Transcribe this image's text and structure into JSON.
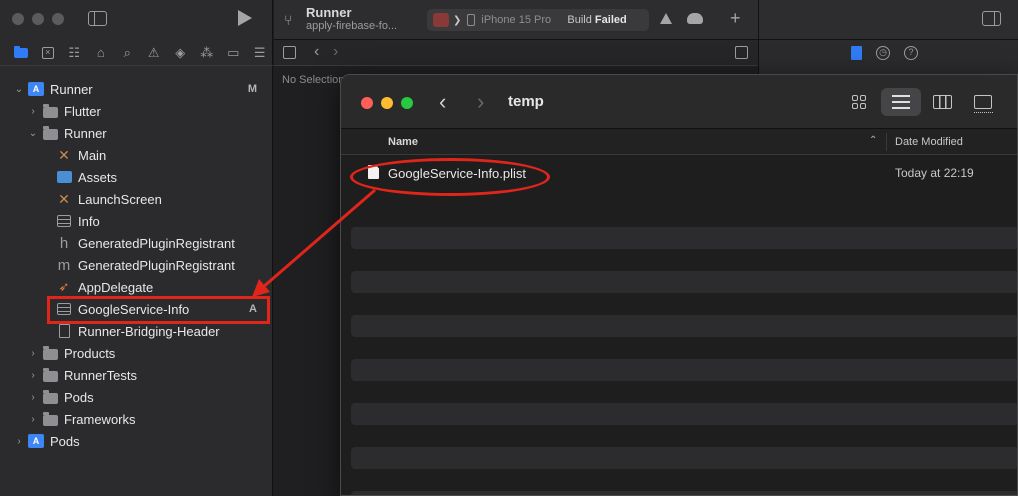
{
  "xcode": {
    "editor_project_title": "Runner",
    "editor_branch": "apply-firebase-fo...",
    "device_name": "iPhone 15 Pro",
    "build_status_prefix": "Build",
    "build_status": "Failed",
    "no_selection": "No Selection",
    "sidebar": {
      "tree": [
        {
          "label": "Runner",
          "badge": "M"
        },
        {
          "label": "Flutter"
        },
        {
          "label": "Runner"
        },
        {
          "label": "Main"
        },
        {
          "label": "Assets"
        },
        {
          "label": "LaunchScreen"
        },
        {
          "label": "Info"
        },
        {
          "label": "GeneratedPluginRegistrant",
          "icon_letter": "h"
        },
        {
          "label": "GeneratedPluginRegistrant",
          "icon_letter": "m"
        },
        {
          "label": "AppDelegate"
        },
        {
          "label": "GoogleService-Info",
          "badge": "A"
        },
        {
          "label": "Runner-Bridging-Header"
        },
        {
          "label": "Products"
        },
        {
          "label": "RunnerTests"
        },
        {
          "label": "Pods"
        },
        {
          "label": "Frameworks"
        },
        {
          "label": "Pods"
        }
      ]
    }
  },
  "finder": {
    "title": "temp",
    "columns": {
      "name": "Name",
      "date_modified": "Date Modified"
    },
    "files": [
      {
        "name": "GoogleService-Info.plist",
        "date_modified": "Today at 22:19"
      }
    ]
  },
  "colors": {
    "annotation_red": "#e0251b",
    "accent_blue": "#2f7cf6",
    "close": "#ff5f57",
    "minimize": "#febc2e",
    "maximize": "#28c840"
  }
}
